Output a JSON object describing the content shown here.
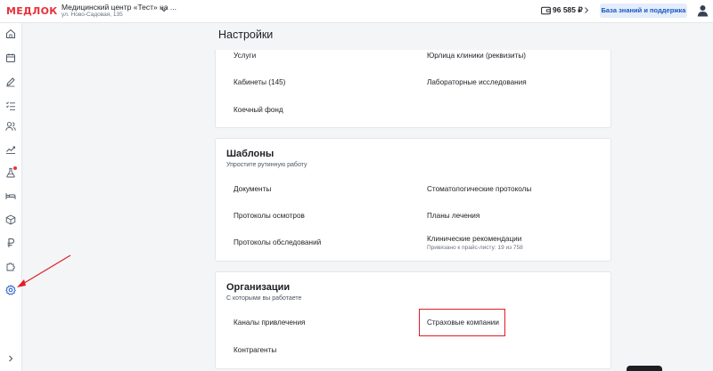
{
  "header": {
    "logo": "МЕДЛОК",
    "clinic_name": "Медицинский центр «Тест» на ...",
    "clinic_address": "ул. Ново-Садовая, 135",
    "balance": "96 585 ₽",
    "kb_button": "База знаний и поддержка"
  },
  "page": {
    "title": "Настройки"
  },
  "cards": {
    "main": {
      "left": [
        "Услуги",
        "Кабинеты (145)",
        "Коечный фонд"
      ],
      "right": [
        "Юрлица клиники (реквизиты)",
        "Лабораторные исследования"
      ]
    },
    "templates": {
      "title": "Шаблоны",
      "subtitle": "Упростите рутинную работу",
      "left": [
        "Документы",
        "Протоколы осмотров",
        "Протоколы обследований"
      ],
      "right": [
        "Стоматологические протоколы",
        "Планы лечения",
        "Клинические рекомендации"
      ],
      "right_note": "Привязано к прайс-листу: 19 из 758"
    },
    "organizations": {
      "title": "Организации",
      "subtitle": "С которыми вы работаете",
      "left": [
        "Каналы привлечения",
        "Контрагенты"
      ],
      "right": [
        "Страховые компании"
      ]
    }
  },
  "colors": {
    "logo": "#e8323c",
    "accent": "#1a56c4",
    "highlight": "#e11d26"
  }
}
